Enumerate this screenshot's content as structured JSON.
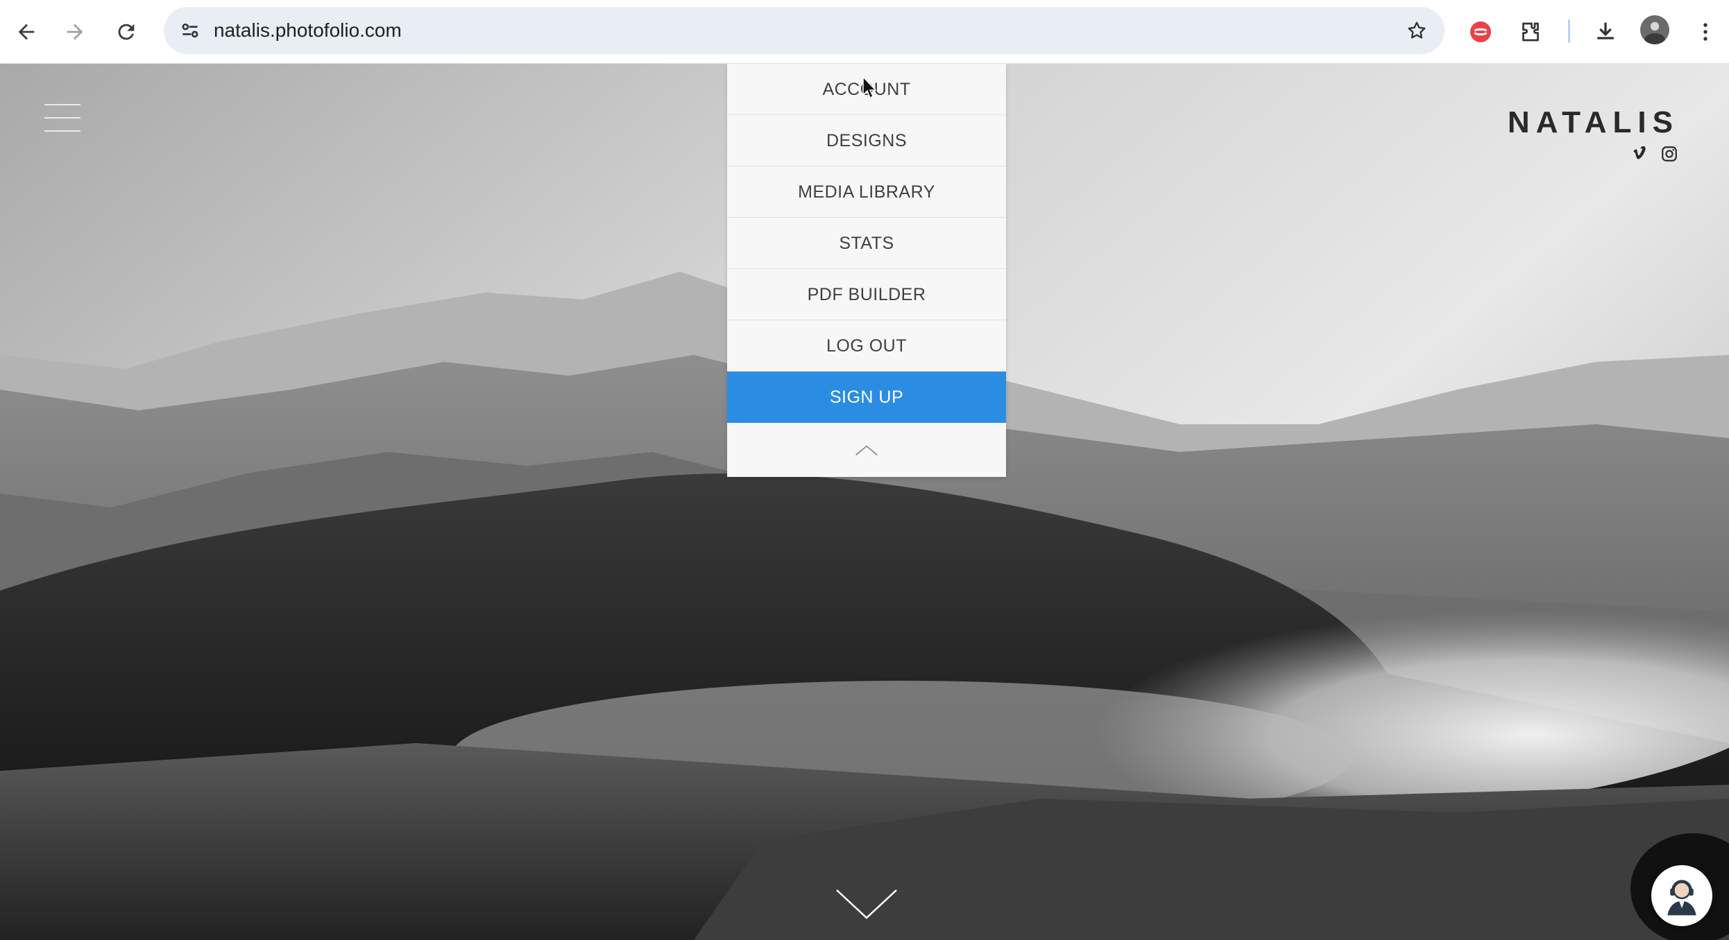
{
  "browser": {
    "url": "natalis.photofolio.com",
    "icons": [
      "back-arrow-icon",
      "forward-arrow-icon",
      "reload-icon",
      "site-settings-icon",
      "bookmark-star-icon",
      "extension-red-icon",
      "extensions-puzzle-icon",
      "download-icon",
      "profile-avatar",
      "more-menu-icon"
    ]
  },
  "site": {
    "brand": "NATALIS",
    "social": [
      "vimeo-icon",
      "instagram-icon"
    ]
  },
  "menu": {
    "items": [
      {
        "label": "ACCOUNT"
      },
      {
        "label": "DESIGNS"
      },
      {
        "label": "MEDIA LIBRARY"
      },
      {
        "label": "STATS"
      },
      {
        "label": "PDF BUILDER"
      },
      {
        "label": "LOG OUT"
      }
    ],
    "signup": "SIGN UP",
    "collapse_icon": "chevron-up-icon"
  },
  "colors": {
    "signup_bg": "#2b8ce3",
    "omnibox_bg": "#e9eef5"
  }
}
